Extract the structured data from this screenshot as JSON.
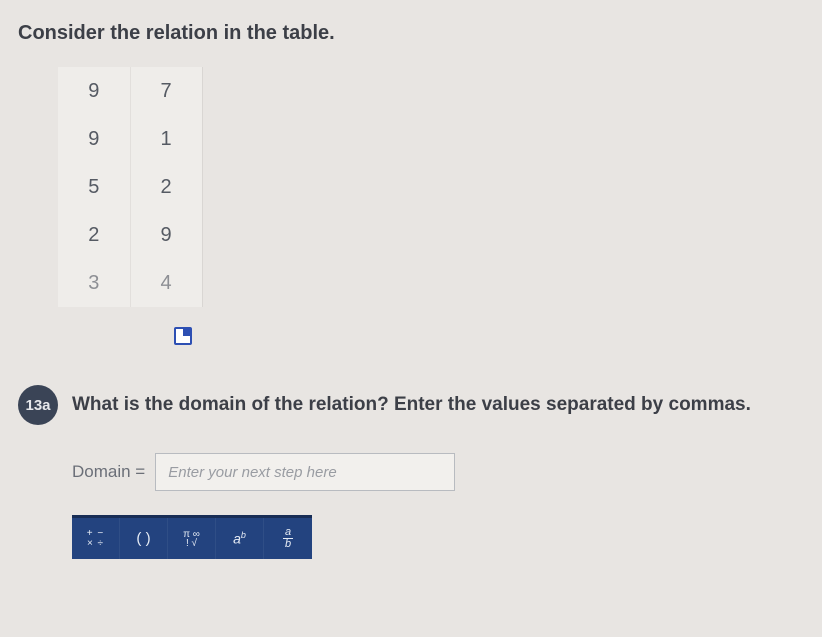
{
  "instruction": "Consider the relation in the table.",
  "table": {
    "rows": [
      {
        "c1": "9",
        "c2": "7"
      },
      {
        "c1": "9",
        "c2": "1"
      },
      {
        "c1": "5",
        "c2": "2"
      },
      {
        "c1": "2",
        "c2": "9"
      },
      {
        "c1": "3",
        "c2": "4"
      }
    ]
  },
  "question": {
    "badge": "13a",
    "text": "What is the domain of the relation? Enter the values separated by commas."
  },
  "answer": {
    "label": "Domain =",
    "placeholder": "Enter your next step here"
  },
  "toolbar": {
    "plusminus_top": "+ −",
    "plusminus_bot": "× ÷",
    "parens": "( )",
    "pi_top": "π ∞",
    "pi_bot": "! √",
    "exp_base": "a",
    "exp_sup": "b",
    "frac_top": "a",
    "frac_bot": "b"
  }
}
